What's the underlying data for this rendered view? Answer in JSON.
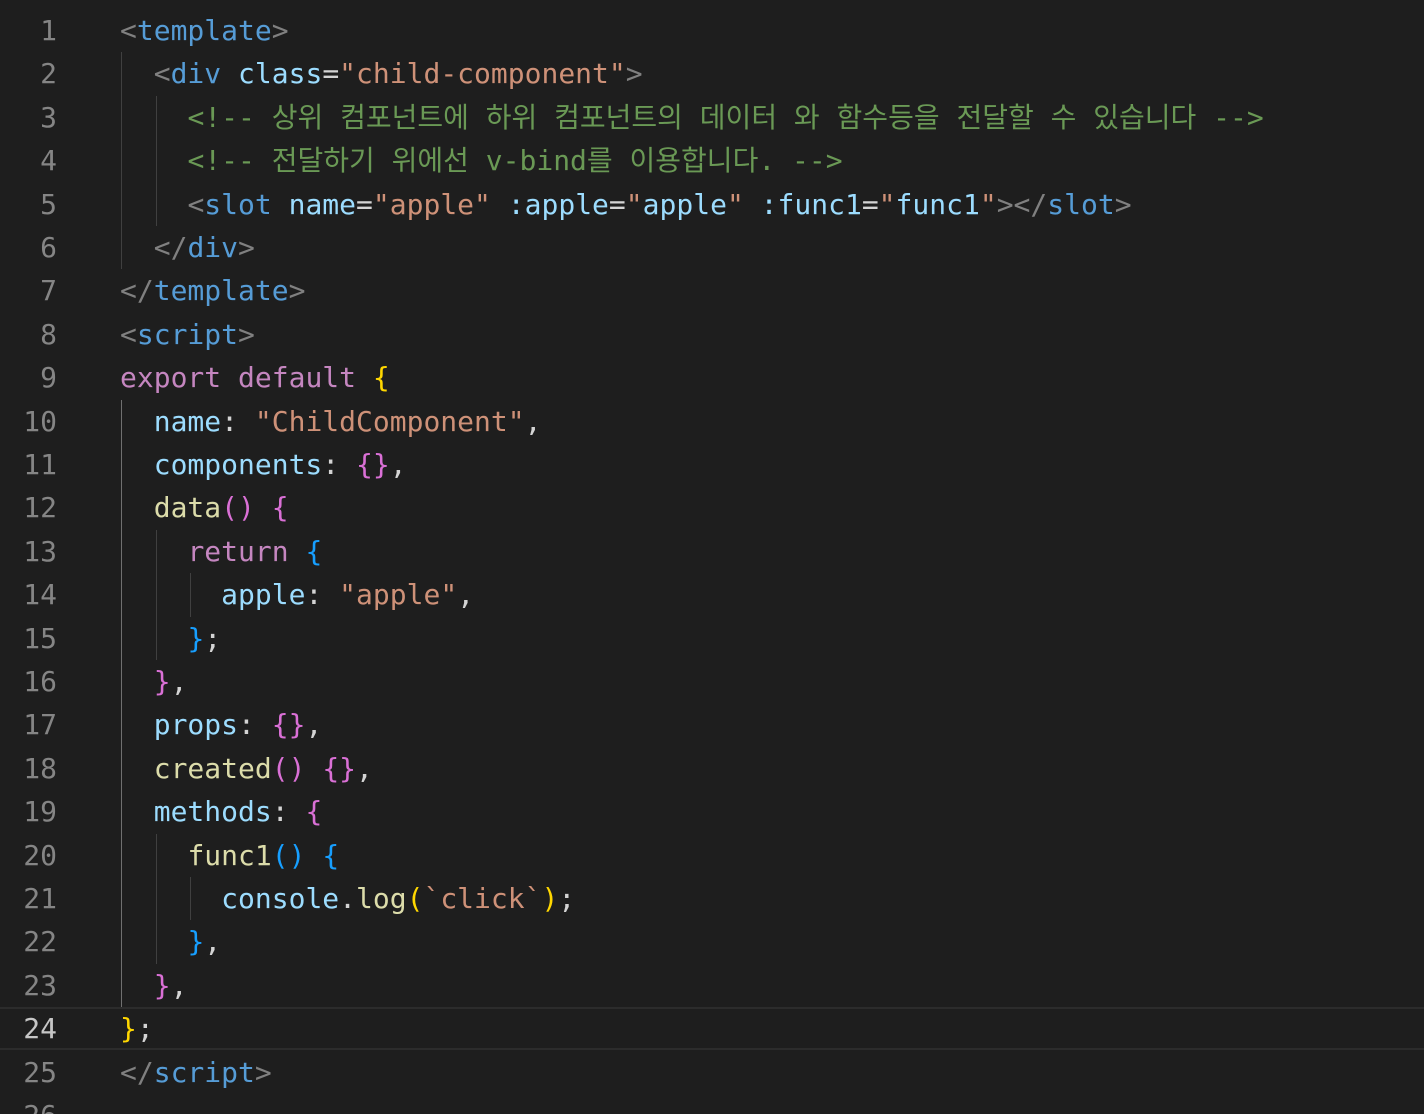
{
  "editor": {
    "language": "vue",
    "active_line": "24",
    "colors": {
      "background": "#1e1e1e",
      "line_number": "#858585",
      "tag": "#569cd6",
      "attribute": "#9cdcfe",
      "string": "#ce9178",
      "comment": "#6a9955",
      "keyword": "#c586c0",
      "function": "#dcdcaa",
      "bracket_1": "#ffd700",
      "bracket_2": "#da70d6",
      "bracket_3": "#179fff"
    },
    "lines": [
      {
        "n": "1",
        "tokens": [
          {
            "t": "<",
            "c": "punc"
          },
          {
            "t": "template",
            "c": "tag"
          },
          {
            "t": ">",
            "c": "punc"
          }
        ]
      },
      {
        "n": "2",
        "tokens": [
          {
            "t": "  ",
            "c": "txt"
          },
          {
            "t": "<",
            "c": "punc"
          },
          {
            "t": "div",
            "c": "tag"
          },
          {
            "t": " ",
            "c": "txt"
          },
          {
            "t": "class",
            "c": "attr"
          },
          {
            "t": "=",
            "c": "txt"
          },
          {
            "t": "\"child-component\"",
            "c": "str"
          },
          {
            "t": ">",
            "c": "punc"
          }
        ]
      },
      {
        "n": "3",
        "tokens": [
          {
            "t": "    ",
            "c": "txt"
          },
          {
            "t": "<!-- 상위 컴포넌트에 하위 컴포넌트의 데이터 와 함수등을 전달할 수 있습니다 -->",
            "c": "cmt"
          }
        ]
      },
      {
        "n": "4",
        "tokens": [
          {
            "t": "    ",
            "c": "txt"
          },
          {
            "t": "<!-- 전달하기 위에선 v-bind를 이용합니다. -->",
            "c": "cmt"
          }
        ]
      },
      {
        "n": "5",
        "tokens": [
          {
            "t": "    ",
            "c": "txt"
          },
          {
            "t": "<",
            "c": "punc"
          },
          {
            "t": "slot",
            "c": "tag"
          },
          {
            "t": " ",
            "c": "txt"
          },
          {
            "t": "name",
            "c": "attr"
          },
          {
            "t": "=",
            "c": "txt"
          },
          {
            "t": "\"apple\"",
            "c": "str"
          },
          {
            "t": " ",
            "c": "txt"
          },
          {
            "t": ":apple",
            "c": "attr"
          },
          {
            "t": "=",
            "c": "txt"
          },
          {
            "t": "\"",
            "c": "str"
          },
          {
            "t": "apple",
            "c": "attr"
          },
          {
            "t": "\"",
            "c": "str"
          },
          {
            "t": " ",
            "c": "txt"
          },
          {
            "t": ":func1",
            "c": "attr"
          },
          {
            "t": "=",
            "c": "txt"
          },
          {
            "t": "\"",
            "c": "str"
          },
          {
            "t": "func1",
            "c": "attr"
          },
          {
            "t": "\"",
            "c": "str"
          },
          {
            "t": "></",
            "c": "punc"
          },
          {
            "t": "slot",
            "c": "tag"
          },
          {
            "t": ">",
            "c": "punc"
          }
        ]
      },
      {
        "n": "6",
        "tokens": [
          {
            "t": "  ",
            "c": "txt"
          },
          {
            "t": "</",
            "c": "punc"
          },
          {
            "t": "div",
            "c": "tag"
          },
          {
            "t": ">",
            "c": "punc"
          }
        ]
      },
      {
        "n": "7",
        "tokens": [
          {
            "t": "</",
            "c": "punc"
          },
          {
            "t": "template",
            "c": "tag"
          },
          {
            "t": ">",
            "c": "punc"
          }
        ]
      },
      {
        "n": "8",
        "tokens": [
          {
            "t": "<",
            "c": "punc"
          },
          {
            "t": "script",
            "c": "tag"
          },
          {
            "t": ">",
            "c": "punc"
          }
        ]
      },
      {
        "n": "9",
        "tokens": [
          {
            "t": "export",
            "c": "kw"
          },
          {
            "t": " ",
            "c": "txt"
          },
          {
            "t": "default",
            "c": "kw"
          },
          {
            "t": " ",
            "c": "txt"
          },
          {
            "t": "{",
            "c": "b1"
          }
        ]
      },
      {
        "n": "10",
        "tokens": [
          {
            "t": "  ",
            "c": "txt"
          },
          {
            "t": "name",
            "c": "prop"
          },
          {
            "t": ": ",
            "c": "txt"
          },
          {
            "t": "\"ChildComponent\"",
            "c": "str"
          },
          {
            "t": ",",
            "c": "txt"
          }
        ]
      },
      {
        "n": "11",
        "tokens": [
          {
            "t": "  ",
            "c": "txt"
          },
          {
            "t": "components",
            "c": "prop"
          },
          {
            "t": ": ",
            "c": "txt"
          },
          {
            "t": "{}",
            "c": "b2"
          },
          {
            "t": ",",
            "c": "txt"
          }
        ]
      },
      {
        "n": "12",
        "tokens": [
          {
            "t": "  ",
            "c": "txt"
          },
          {
            "t": "data",
            "c": "fn"
          },
          {
            "t": "()",
            "c": "b2"
          },
          {
            "t": " ",
            "c": "txt"
          },
          {
            "t": "{",
            "c": "b2"
          }
        ]
      },
      {
        "n": "13",
        "tokens": [
          {
            "t": "    ",
            "c": "txt"
          },
          {
            "t": "return",
            "c": "kw"
          },
          {
            "t": " ",
            "c": "txt"
          },
          {
            "t": "{",
            "c": "b3"
          }
        ]
      },
      {
        "n": "14",
        "tokens": [
          {
            "t": "      ",
            "c": "txt"
          },
          {
            "t": "apple",
            "c": "prop"
          },
          {
            "t": ": ",
            "c": "txt"
          },
          {
            "t": "\"apple\"",
            "c": "str"
          },
          {
            "t": ",",
            "c": "txt"
          }
        ]
      },
      {
        "n": "15",
        "tokens": [
          {
            "t": "    ",
            "c": "txt"
          },
          {
            "t": "}",
            "c": "b3"
          },
          {
            "t": ";",
            "c": "txt"
          }
        ]
      },
      {
        "n": "16",
        "tokens": [
          {
            "t": "  ",
            "c": "txt"
          },
          {
            "t": "}",
            "c": "b2"
          },
          {
            "t": ",",
            "c": "txt"
          }
        ]
      },
      {
        "n": "17",
        "tokens": [
          {
            "t": "  ",
            "c": "txt"
          },
          {
            "t": "props",
            "c": "prop"
          },
          {
            "t": ": ",
            "c": "txt"
          },
          {
            "t": "{}",
            "c": "b2"
          },
          {
            "t": ",",
            "c": "txt"
          }
        ]
      },
      {
        "n": "18",
        "tokens": [
          {
            "t": "  ",
            "c": "txt"
          },
          {
            "t": "created",
            "c": "fn"
          },
          {
            "t": "()",
            "c": "b2"
          },
          {
            "t": " ",
            "c": "txt"
          },
          {
            "t": "{}",
            "c": "b2"
          },
          {
            "t": ",",
            "c": "txt"
          }
        ]
      },
      {
        "n": "19",
        "tokens": [
          {
            "t": "  ",
            "c": "txt"
          },
          {
            "t": "methods",
            "c": "prop"
          },
          {
            "t": ": ",
            "c": "txt"
          },
          {
            "t": "{",
            "c": "b2"
          }
        ]
      },
      {
        "n": "20",
        "tokens": [
          {
            "t": "    ",
            "c": "txt"
          },
          {
            "t": "func1",
            "c": "fn"
          },
          {
            "t": "()",
            "c": "b3"
          },
          {
            "t": " ",
            "c": "txt"
          },
          {
            "t": "{",
            "c": "b3"
          }
        ]
      },
      {
        "n": "21",
        "tokens": [
          {
            "t": "      ",
            "c": "txt"
          },
          {
            "t": "console",
            "c": "prop"
          },
          {
            "t": ".",
            "c": "txt"
          },
          {
            "t": "log",
            "c": "fn"
          },
          {
            "t": "(",
            "c": "b1"
          },
          {
            "t": "`click`",
            "c": "str"
          },
          {
            "t": ")",
            "c": "b1"
          },
          {
            "t": ";",
            "c": "txt"
          }
        ]
      },
      {
        "n": "22",
        "tokens": [
          {
            "t": "    ",
            "c": "txt"
          },
          {
            "t": "}",
            "c": "b3"
          },
          {
            "t": ",",
            "c": "txt"
          }
        ]
      },
      {
        "n": "23",
        "tokens": [
          {
            "t": "  ",
            "c": "txt"
          },
          {
            "t": "}",
            "c": "b2"
          },
          {
            "t": ",",
            "c": "txt"
          }
        ]
      },
      {
        "n": "24",
        "tokens": [
          {
            "t": "}",
            "c": "b1"
          },
          {
            "t": ";",
            "c": "txt"
          }
        ]
      },
      {
        "n": "25",
        "tokens": [
          {
            "t": "</",
            "c": "punc"
          },
          {
            "t": "script",
            "c": "tag"
          },
          {
            "t": ">",
            "c": "punc"
          }
        ]
      },
      {
        "n": "26",
        "tokens": []
      }
    ]
  }
}
